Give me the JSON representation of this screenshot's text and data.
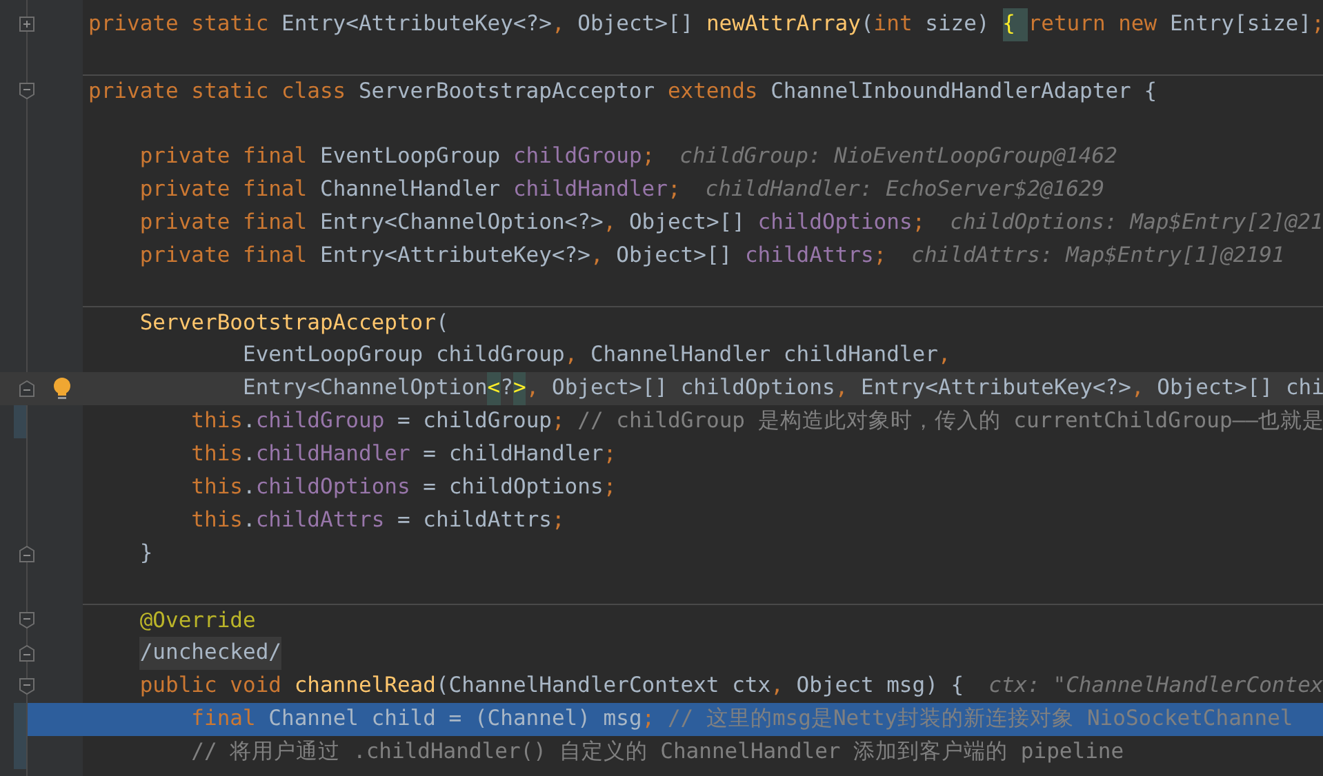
{
  "editor": {
    "lines": [
      {
        "fold": {
          "kind": "plus"
        },
        "separator_above": false,
        "selected": false,
        "current": false,
        "bulb": false,
        "changed": false,
        "tokens": [
          {
            "kind": "keyword",
            "text": "private static "
          },
          {
            "kind": "plain",
            "text": "Entry<AttributeKey<?>"
          },
          {
            "kind": "keyword",
            "text": ", "
          },
          {
            "kind": "plain",
            "text": "Object>[] "
          },
          {
            "kind": "method",
            "text": "newAttrArray"
          },
          {
            "kind": "plain",
            "text": "("
          },
          {
            "kind": "keyword",
            "text": "int "
          },
          {
            "kind": "plain",
            "text": "size) "
          },
          {
            "kind": "matched",
            "text": "{ "
          },
          {
            "kind": "keyword",
            "text": "return new "
          },
          {
            "kind": "plain",
            "text": "Entry[size]"
          },
          {
            "kind": "keyword",
            "text": ";"
          }
        ]
      },
      {
        "separator_above": false,
        "selected": false,
        "current": false,
        "bulb": false,
        "changed": false
      },
      {
        "fold": {
          "kind": "minus"
        },
        "separator_above": true,
        "selected": false,
        "current": false,
        "bulb": false,
        "changed": false,
        "tokens": [
          {
            "kind": "keyword",
            "text": "private static class "
          },
          {
            "kind": "plain",
            "text": "ServerBootstrapAcceptor "
          },
          {
            "kind": "keyword",
            "text": "extends "
          },
          {
            "kind": "plain",
            "text": "ChannelInboundHandlerAdapter {"
          }
        ]
      },
      {
        "separator_above": false,
        "selected": false,
        "current": false,
        "bulb": false,
        "changed": false
      },
      {
        "separator_above": false,
        "selected": false,
        "current": false,
        "bulb": false,
        "changed": false,
        "tokens": [
          {
            "kind": "keyword",
            "text": "    private final "
          },
          {
            "kind": "plain",
            "text": "EventLoopGroup "
          },
          {
            "kind": "field",
            "text": "childGroup"
          },
          {
            "kind": "keyword",
            "text": ";"
          },
          {
            "kind": "hint",
            "text": "childGroup: NioEventLoopGroup@1462"
          }
        ]
      },
      {
        "separator_above": false,
        "selected": false,
        "current": false,
        "bulb": false,
        "changed": false,
        "tokens": [
          {
            "kind": "keyword",
            "text": "    private final "
          },
          {
            "kind": "plain",
            "text": "ChannelHandler "
          },
          {
            "kind": "field",
            "text": "childHandler"
          },
          {
            "kind": "keyword",
            "text": ";"
          },
          {
            "kind": "hint",
            "text": "childHandler: EchoServer$2@1629"
          }
        ]
      },
      {
        "separator_above": false,
        "selected": false,
        "current": false,
        "bulb": false,
        "changed": false,
        "tokens": [
          {
            "kind": "keyword",
            "text": "    private final "
          },
          {
            "kind": "plain",
            "text": "Entry<ChannelOption<?>"
          },
          {
            "kind": "keyword",
            "text": ", "
          },
          {
            "kind": "plain",
            "text": "Object>[] "
          },
          {
            "kind": "field",
            "text": "childOptions"
          },
          {
            "kind": "keyword",
            "text": ";"
          },
          {
            "kind": "hint",
            "text": "childOptions: Map$Entry[2]@21"
          }
        ]
      },
      {
        "separator_above": false,
        "selected": false,
        "current": false,
        "bulb": false,
        "changed": false,
        "tokens": [
          {
            "kind": "keyword",
            "text": "    private final "
          },
          {
            "kind": "plain",
            "text": "Entry<AttributeKey<?>"
          },
          {
            "kind": "keyword",
            "text": ", "
          },
          {
            "kind": "plain",
            "text": "Object>[] "
          },
          {
            "kind": "field",
            "text": "childAttrs"
          },
          {
            "kind": "keyword",
            "text": ";"
          },
          {
            "kind": "hint",
            "text": "childAttrs: Map$Entry[1]@2191"
          }
        ]
      },
      {
        "separator_above": false,
        "selected": false,
        "current": false,
        "bulb": false,
        "changed": false
      },
      {
        "separator_above": true,
        "selected": false,
        "current": false,
        "bulb": false,
        "changed": false,
        "tokens": [
          {
            "kind": "method",
            "text": "    ServerBootstrapAcceptor"
          },
          {
            "kind": "plain",
            "text": "("
          }
        ]
      },
      {
        "separator_above": false,
        "selected": false,
        "current": false,
        "bulb": false,
        "changed": false,
        "tokens": [
          {
            "kind": "plain",
            "text": "            EventLoopGroup childGroup"
          },
          {
            "kind": "keyword",
            "text": ", "
          },
          {
            "kind": "plain",
            "text": "ChannelHandler childHandler"
          },
          {
            "kind": "keyword",
            "text": ","
          }
        ]
      },
      {
        "fold": {
          "kind": "end"
        },
        "separator_above": false,
        "selected": false,
        "current": true,
        "bulb": true,
        "changed": false,
        "tokens": [
          {
            "kind": "plain",
            "text": "            Entry<ChannelOption"
          },
          {
            "kind": "matched",
            "text": "<"
          },
          {
            "kind": "plain",
            "text": "?"
          },
          {
            "kind": "matched",
            "text": ">"
          },
          {
            "kind": "keyword",
            "text": ", "
          },
          {
            "kind": "plain",
            "text": "Object>[] childOptions"
          },
          {
            "kind": "keyword",
            "text": ", "
          },
          {
            "kind": "plain",
            "text": "Entry<AttributeKey<?>"
          },
          {
            "kind": "keyword",
            "text": ", "
          },
          {
            "kind": "plain",
            "text": "Object>[] chi"
          }
        ]
      },
      {
        "separator_above": false,
        "selected": false,
        "current": false,
        "bulb": false,
        "changed": true,
        "tokens": [
          {
            "kind": "keyword",
            "text": "        this"
          },
          {
            "kind": "plain",
            "text": "."
          },
          {
            "kind": "field",
            "text": "childGroup"
          },
          {
            "kind": "plain",
            "text": " = childGroup"
          },
          {
            "kind": "keyword",
            "text": ";"
          },
          {
            "kind": "comment",
            "text": " // childGroup 是构造此对象时，传入的 currentChildGroup——也就是"
          }
        ]
      },
      {
        "separator_above": false,
        "selected": false,
        "current": false,
        "bulb": false,
        "changed": false,
        "tokens": [
          {
            "kind": "keyword",
            "text": "        this"
          },
          {
            "kind": "plain",
            "text": "."
          },
          {
            "kind": "field",
            "text": "childHandler"
          },
          {
            "kind": "plain",
            "text": " = childHandler"
          },
          {
            "kind": "keyword",
            "text": ";"
          }
        ]
      },
      {
        "separator_above": false,
        "selected": false,
        "current": false,
        "bulb": false,
        "changed": false,
        "tokens": [
          {
            "kind": "keyword",
            "text": "        this"
          },
          {
            "kind": "plain",
            "text": "."
          },
          {
            "kind": "field",
            "text": "childOptions"
          },
          {
            "kind": "plain",
            "text": " = childOptions"
          },
          {
            "kind": "keyword",
            "text": ";"
          }
        ]
      },
      {
        "separator_above": false,
        "selected": false,
        "current": false,
        "bulb": false,
        "changed": false,
        "tokens": [
          {
            "kind": "keyword",
            "text": "        this"
          },
          {
            "kind": "plain",
            "text": "."
          },
          {
            "kind": "field",
            "text": "childAttrs"
          },
          {
            "kind": "plain",
            "text": " = childAttrs"
          },
          {
            "kind": "keyword",
            "text": ";"
          }
        ]
      },
      {
        "fold": {
          "kind": "end"
        },
        "separator_above": false,
        "selected": false,
        "current": false,
        "bulb": false,
        "changed": false,
        "tokens": [
          {
            "kind": "plain",
            "text": "    }"
          }
        ]
      },
      {
        "separator_above": false,
        "selected": false,
        "current": false,
        "bulb": false,
        "changed": false
      },
      {
        "fold": {
          "kind": "minus"
        },
        "separator_above": true,
        "selected": false,
        "current": false,
        "bulb": false,
        "changed": false,
        "tokens": [
          {
            "kind": "annotation",
            "text": "    @Override"
          }
        ]
      },
      {
        "fold": {
          "kind": "end"
        },
        "separator_above": false,
        "selected": false,
        "current": false,
        "bulb": false,
        "changed": false,
        "tokens": [
          {
            "kind": "folded",
            "text": "    /unchecked/"
          }
        ]
      },
      {
        "fold": {
          "kind": "minus"
        },
        "separator_above": false,
        "selected": false,
        "current": false,
        "bulb": false,
        "changed": false,
        "tokens": [
          {
            "kind": "keyword",
            "text": "    public void "
          },
          {
            "kind": "method",
            "text": "channelRead"
          },
          {
            "kind": "plain",
            "text": "(ChannelHandlerContext ctx"
          },
          {
            "kind": "keyword",
            "text": ", "
          },
          {
            "kind": "plain",
            "text": "Object msg) {"
          },
          {
            "kind": "hint",
            "text": "ctx: \"ChannelHandlerContex"
          }
        ]
      },
      {
        "separator_above": false,
        "selected": true,
        "current": false,
        "bulb": false,
        "changed": true,
        "tokens": [
          {
            "kind": "keyword",
            "text": "        final "
          },
          {
            "kind": "plain",
            "text": "Channel child = (Channel) msg"
          },
          {
            "kind": "keyword",
            "text": ";"
          },
          {
            "kind": "comment",
            "text": " // 这里的msg是Netty封装的新连接对象 NioSocketChannel"
          }
        ]
      },
      {
        "separator_above": false,
        "selected": false,
        "current": false,
        "bulb": false,
        "changed": true,
        "tokens": [
          {
            "kind": "comment",
            "text": "        // 将用户通过 .childHandler() 自定义的 ChannelHandler 添加到客户端的 pipeline"
          }
        ]
      }
    ]
  }
}
